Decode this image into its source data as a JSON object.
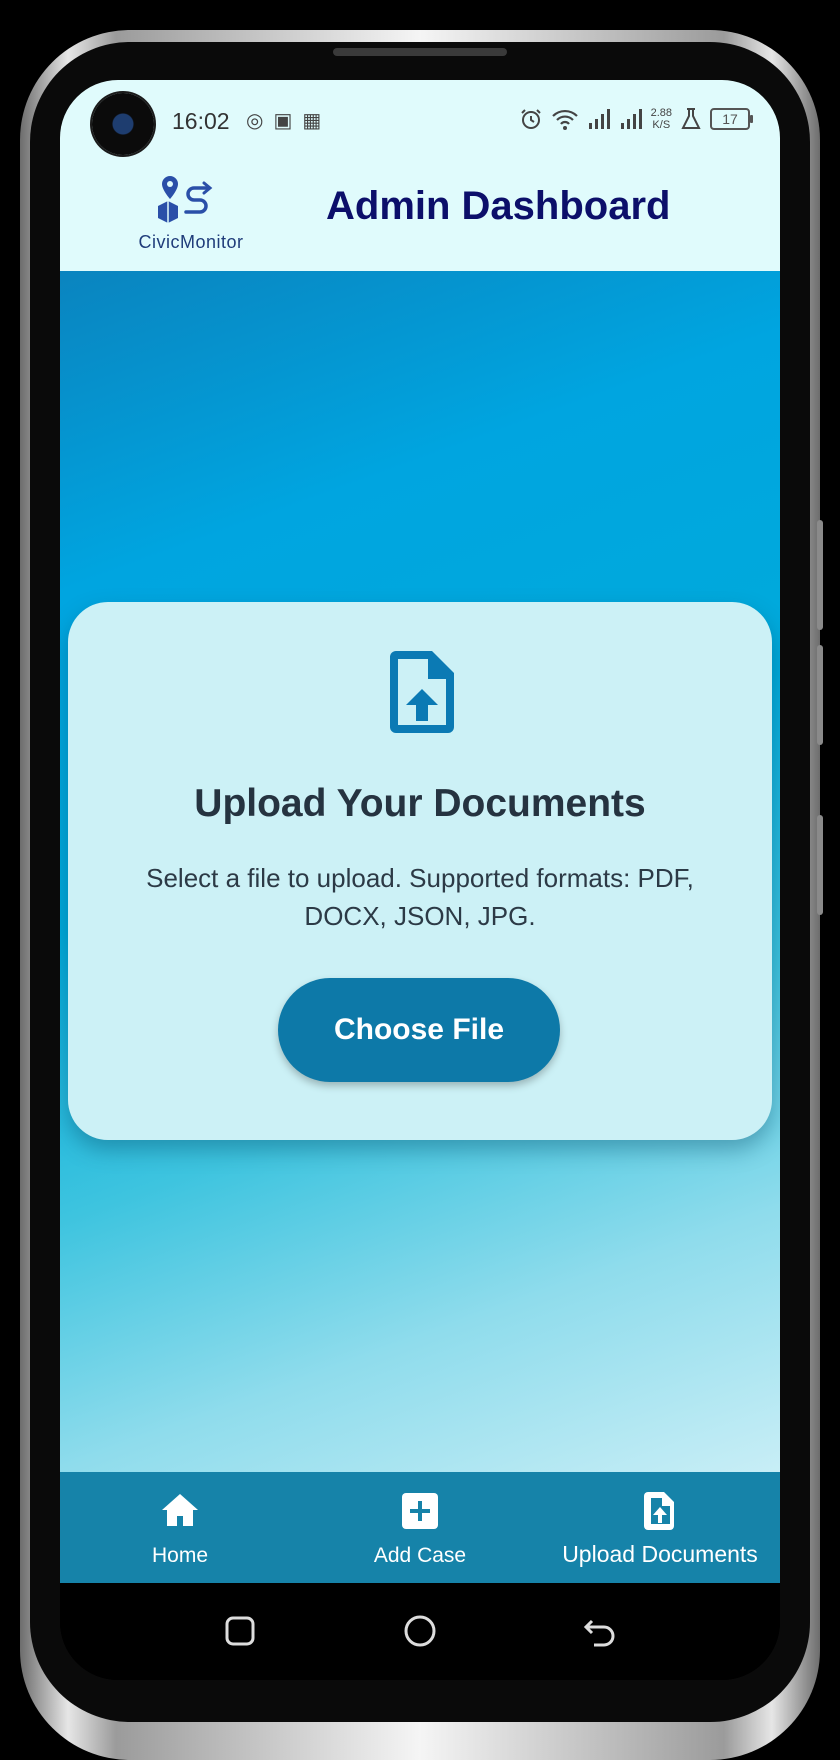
{
  "status_bar": {
    "time": "16:02",
    "left_icons": [
      "notification-icon",
      "shopping-bag-icon",
      "app-icon"
    ],
    "right_icons": [
      "alarm-icon",
      "wifi-icon",
      "signal-icon",
      "signal-icon"
    ],
    "net_speed_value": "2.88",
    "net_speed_unit": "K/S",
    "battery": "17"
  },
  "app_bar": {
    "logo_text": "CivicMonitor",
    "title": "Admin Dashboard"
  },
  "upload_card": {
    "icon": "file-upload-icon",
    "title": "Upload Your Documents",
    "description": "Select a file to upload. Supported formats: PDF, DOCX, JSON, JPG.",
    "button_label": "Choose File"
  },
  "bottom_nav": {
    "items": [
      {
        "label": "Home",
        "icon": "home-icon"
      },
      {
        "label": "Add Case",
        "icon": "add-box-icon"
      },
      {
        "label": "Upload Documents",
        "icon": "file-upload-icon",
        "active": true
      }
    ]
  },
  "system_nav": [
    "recents-icon",
    "home-circle-icon",
    "back-icon"
  ],
  "colors": {
    "appbar_bg": "#e0fbfc",
    "title": "#0c0f6a",
    "card_bg": "#ccf1f6",
    "button": "#0d79a8",
    "nav_bg": "#1683a9"
  }
}
